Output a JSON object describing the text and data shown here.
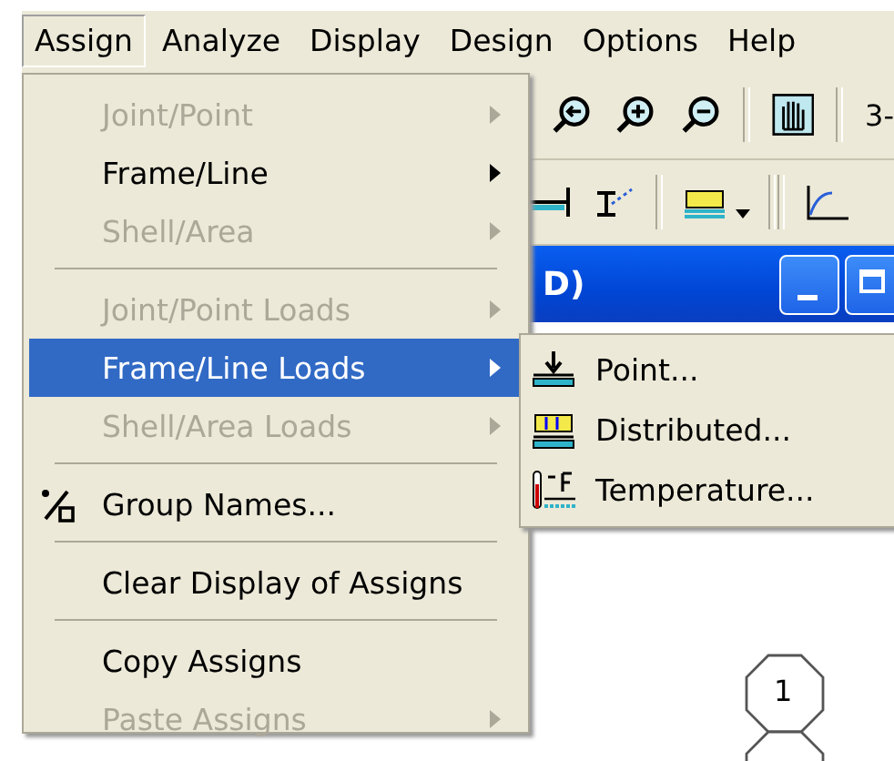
{
  "menu_bar": [
    {
      "label": "Assign",
      "selected": true
    },
    {
      "label": "Analyze",
      "selected": false
    },
    {
      "label": "Display",
      "selected": false
    },
    {
      "label": "Design",
      "selected": false
    },
    {
      "label": "Options",
      "selected": false
    },
    {
      "label": "Help",
      "selected": false
    }
  ],
  "toolbar": {
    "view_label": "3-"
  },
  "document_window": {
    "title": "D)"
  },
  "canvas": {
    "joint_label": "1"
  },
  "assign_menu": {
    "items": [
      {
        "kind": "item",
        "label": "Joint/Point",
        "disabled": true,
        "submenu": true,
        "selected": false,
        "has_icon": false
      },
      {
        "kind": "item",
        "label": "Frame/Line",
        "disabled": false,
        "submenu": true,
        "selected": false,
        "has_icon": false
      },
      {
        "kind": "item",
        "label": "Shell/Area",
        "disabled": true,
        "submenu": true,
        "selected": false,
        "has_icon": false
      },
      {
        "kind": "separator"
      },
      {
        "kind": "item",
        "label": "Joint/Point Loads",
        "disabled": true,
        "submenu": true,
        "selected": false,
        "has_icon": false
      },
      {
        "kind": "item",
        "label": "Frame/Line Loads",
        "disabled": false,
        "submenu": true,
        "selected": true,
        "has_icon": false
      },
      {
        "kind": "item",
        "label": "Shell/Area Loads",
        "disabled": true,
        "submenu": true,
        "selected": false,
        "has_icon": false
      },
      {
        "kind": "separator"
      },
      {
        "kind": "item",
        "label": "Group Names...",
        "disabled": false,
        "submenu": false,
        "selected": false,
        "has_icon": true
      },
      {
        "kind": "separator"
      },
      {
        "kind": "item",
        "label": "Clear Display of Assigns",
        "disabled": false,
        "submenu": false,
        "selected": false,
        "has_icon": false
      },
      {
        "kind": "separator"
      },
      {
        "kind": "item",
        "label": "Copy Assigns",
        "disabled": false,
        "submenu": false,
        "selected": false,
        "has_icon": false
      },
      {
        "kind": "item",
        "label": "Paste Assigns",
        "disabled": true,
        "submenu": true,
        "selected": false,
        "has_icon": false
      }
    ]
  },
  "loads_submenu": {
    "items": [
      {
        "kind": "point",
        "label": "Point..."
      },
      {
        "kind": "distributed",
        "label": "Distributed..."
      },
      {
        "kind": "temperature",
        "label": "Temperature..."
      }
    ]
  }
}
